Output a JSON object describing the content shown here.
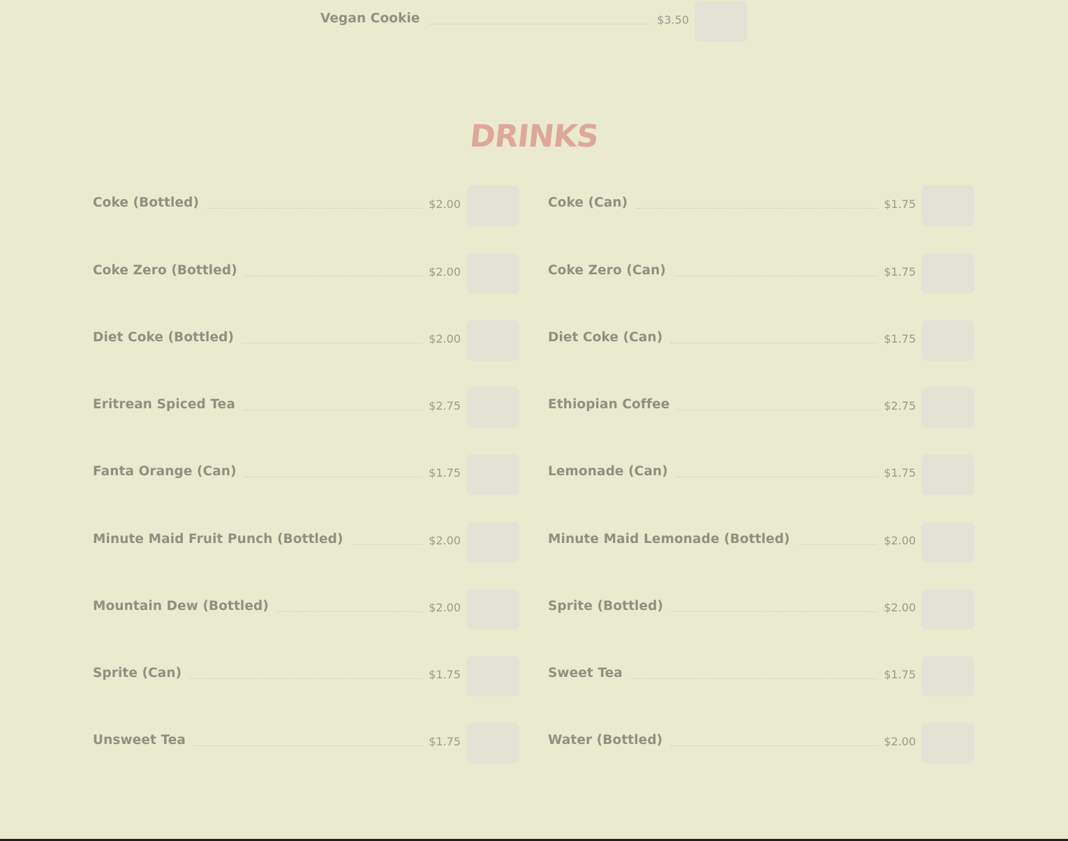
{
  "top_item": {
    "name": "Vegan Cookie",
    "price": "$3.50"
  },
  "drinks": {
    "title": "DRINKS",
    "left_column": [
      {
        "name": "Coke (Bottled)",
        "price": "$2.00"
      },
      {
        "name": "Coke Zero (Bottled)",
        "price": "$2.00"
      },
      {
        "name": "Diet Coke (Bottled)",
        "price": "$2.00"
      },
      {
        "name": "Eritrean Spiced Tea",
        "price": "$2.75"
      },
      {
        "name": "Fanta Orange (Can)",
        "price": "$1.75"
      },
      {
        "name": "Minute Maid Fruit Punch (Bottled)",
        "price": "$2.00"
      },
      {
        "name": "Mountain Dew (Bottled)",
        "price": "$2.00"
      },
      {
        "name": "Sprite (Can)",
        "price": "$1.75"
      },
      {
        "name": "Unsweet Tea",
        "price": "$1.75"
      }
    ],
    "right_column": [
      {
        "name": "Coke (Can)",
        "price": "$1.75"
      },
      {
        "name": "Coke Zero (Can)",
        "price": "$1.75"
      },
      {
        "name": "Diet Coke (Can)",
        "price": "$1.75"
      },
      {
        "name": "Ethiopian Coffee",
        "price": "$2.75"
      },
      {
        "name": "Lemonade (Can)",
        "price": "$1.75"
      },
      {
        "name": "Minute Maid Lemonade (Bottled)",
        "price": "$2.00"
      },
      {
        "name": "Sprite (Bottled)",
        "price": "$2.00"
      },
      {
        "name": "Sweet Tea",
        "price": "$1.75"
      },
      {
        "name": "Water (Bottled)",
        "price": "$2.00"
      }
    ]
  },
  "colors": {
    "background": "#eaeacf",
    "item_text": "#8f917f",
    "price_text": "#999b89",
    "title_accent": "#dea79b",
    "add_button": "#e3e3d5"
  }
}
